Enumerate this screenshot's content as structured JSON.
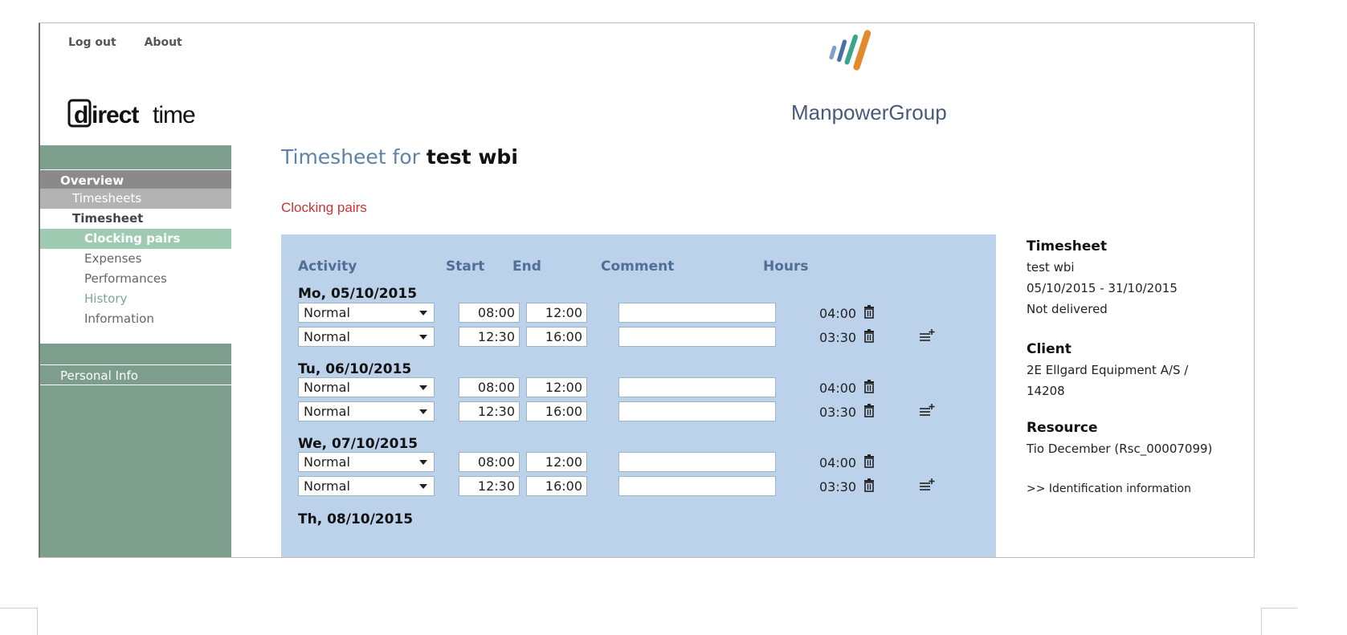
{
  "header": {
    "links": [
      "Log out",
      "About"
    ],
    "brand_logo": "direct time",
    "company_logo": "ManpowerGroup"
  },
  "sidebar": {
    "overview": "Overview",
    "timesheets": "Timesheets",
    "timesheet": "Timesheet",
    "items": [
      "Clocking pairs",
      "Expenses",
      "Performances",
      "History",
      "Information"
    ],
    "personal_info": "Personal Info"
  },
  "page": {
    "title_prefix": "Timesheet for",
    "title_name": "test wbi",
    "section": "Clocking pairs"
  },
  "table": {
    "headers": {
      "activity": "Activity",
      "start": "Start",
      "end": "End",
      "comment": "Comment",
      "hours": "Hours"
    },
    "days": [
      {
        "label": "Mo, 05/10/2015",
        "rows": [
          {
            "activity": "Normal",
            "start": "08:00",
            "end": "12:00",
            "comment": "",
            "hours": "04:00"
          },
          {
            "activity": "Normal",
            "start": "12:30",
            "end": "16:00",
            "comment": "",
            "hours": "03:30"
          }
        ]
      },
      {
        "label": "Tu, 06/10/2015",
        "rows": [
          {
            "activity": "Normal",
            "start": "08:00",
            "end": "12:00",
            "comment": "",
            "hours": "04:00"
          },
          {
            "activity": "Normal",
            "start": "12:30",
            "end": "16:00",
            "comment": "",
            "hours": "03:30"
          }
        ]
      },
      {
        "label": "We, 07/10/2015",
        "rows": [
          {
            "activity": "Normal",
            "start": "08:00",
            "end": "12:00",
            "comment": "",
            "hours": "04:00"
          },
          {
            "activity": "Normal",
            "start": "12:30",
            "end": "16:00",
            "comment": "",
            "hours": "03:30"
          }
        ]
      },
      {
        "label": "Th, 08/10/2015",
        "rows": []
      }
    ]
  },
  "info": {
    "timesheet_heading": "Timesheet",
    "timesheet_name": "test wbi",
    "period": "05/10/2015 - 31/10/2015",
    "status": "Not delivered",
    "client_heading": "Client",
    "client_line1": "2E Ellgard Equipment A/S /",
    "client_line2": "14208",
    "resource_heading": "Resource",
    "resource_value": "Tio December (Rsc_00007099)",
    "identification_link": ">> Identification information"
  },
  "icons": {
    "trash": "trash-icon",
    "add_row": "add-row-icon",
    "dropdown": "chevron-down-icon"
  },
  "colors": {
    "sidebar": "#7d9e8c",
    "panel": "#bcd2ea",
    "section_title": "#cc3333",
    "title_blue": "#5f82a8",
    "active_item": "#9fcbb2"
  }
}
